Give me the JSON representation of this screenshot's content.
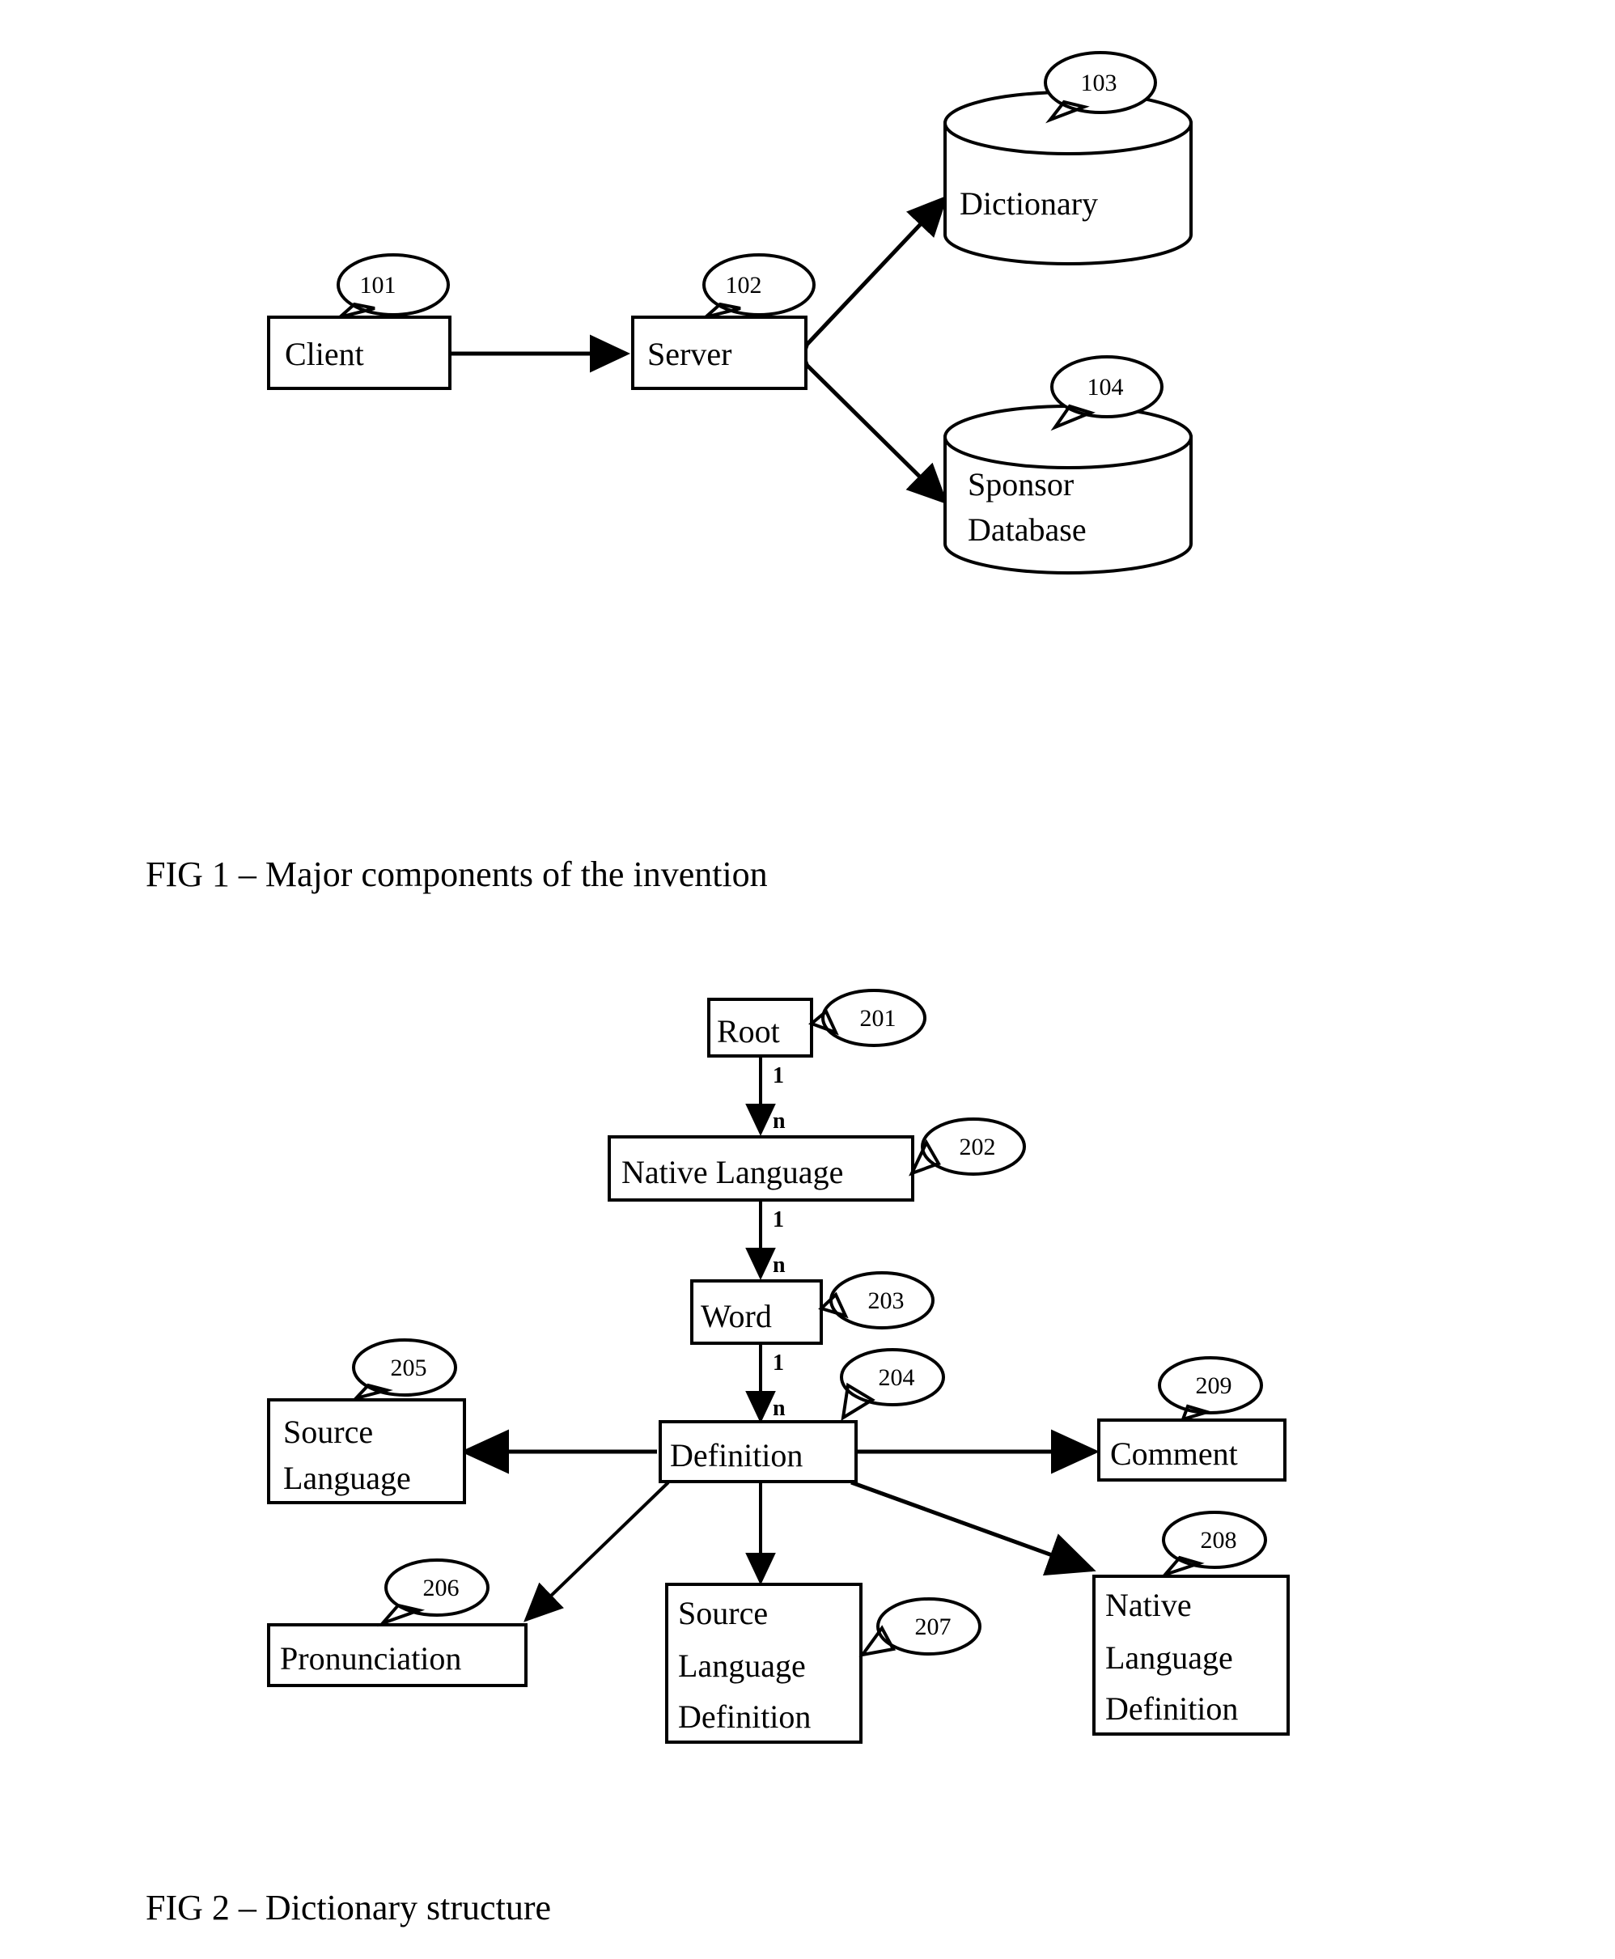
{
  "document": {
    "type": "patent-drawing-sheet",
    "background_color": "#ffffff",
    "line_color": "#000000"
  },
  "figures": [
    {
      "id": "fig1",
      "caption": "FIG 1 – Major components of the invention",
      "nodes": [
        {
          "ref": "101",
          "label": "Client",
          "shape": "rectangle"
        },
        {
          "ref": "102",
          "label": "Server",
          "shape": "rectangle"
        },
        {
          "ref": "103",
          "label": "Dictionary",
          "shape": "cylinder"
        },
        {
          "ref": "104",
          "label": "Sponsor Database",
          "shape": "cylinder",
          "lines": [
            "Sponsor",
            "Database"
          ]
        }
      ],
      "connections": [
        {
          "from": "Client",
          "to": "Server",
          "arrow": "both"
        },
        {
          "from": "Server",
          "to": "Dictionary",
          "arrow": "both"
        },
        {
          "from": "Server",
          "to": "Sponsor Database",
          "arrow": "both"
        }
      ]
    },
    {
      "id": "fig2",
      "caption": "FIG 2 – Dictionary structure",
      "nodes": [
        {
          "ref": "201",
          "label": "Root",
          "lines": [
            "Root"
          ]
        },
        {
          "ref": "202",
          "label": "Native Language",
          "lines": [
            "Native Language"
          ]
        },
        {
          "ref": "203",
          "label": "Word",
          "lines": [
            "Word"
          ]
        },
        {
          "ref": "204",
          "label": "Definition",
          "lines": [
            "Definition"
          ]
        },
        {
          "ref": "205",
          "label": "Source Language",
          "lines": [
            "Source",
            "Language"
          ]
        },
        {
          "ref": "206",
          "label": "Pronunciation",
          "lines": [
            "Pronunciation"
          ]
        },
        {
          "ref": "207",
          "label": "Source Language Definition",
          "lines": [
            "Source",
            "Language",
            "Definition"
          ]
        },
        {
          "ref": "208",
          "label": "Native Language Definition",
          "lines": [
            "Native",
            "Language",
            "Definition"
          ]
        },
        {
          "ref": "209",
          "label": "Comment",
          "lines": [
            "Comment"
          ]
        }
      ],
      "connections": [
        {
          "from": "Root",
          "to": "Native Language",
          "from_card": "1",
          "to_card": "n",
          "arrow": "to"
        },
        {
          "from": "Native Language",
          "to": "Word",
          "from_card": "1",
          "to_card": "n",
          "arrow": "to"
        },
        {
          "from": "Word",
          "to": "Definition",
          "from_card": "1",
          "to_card": "n",
          "arrow": "to"
        },
        {
          "from": "Definition",
          "to": "Source Language",
          "arrow": "to"
        },
        {
          "from": "Definition",
          "to": "Comment",
          "arrow": "to"
        },
        {
          "from": "Definition",
          "to": "Pronunciation",
          "arrow": "to"
        },
        {
          "from": "Definition",
          "to": "Source Language Definition",
          "arrow": "to"
        },
        {
          "from": "Definition",
          "to": "Native Language Definition",
          "arrow": "to"
        }
      ],
      "cardinality_labels": {
        "one": "1",
        "many": "n"
      }
    }
  ]
}
